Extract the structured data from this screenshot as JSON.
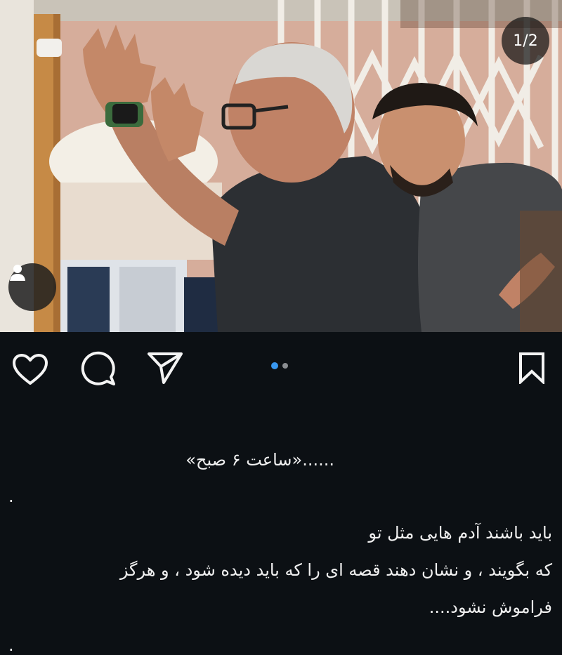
{
  "post": {
    "counter": "1/2",
    "photo_alt": "Photo of two men on a film set",
    "carousel": {
      "count": 2,
      "active": 1
    }
  },
  "actions": {
    "like_icon": "heart-icon",
    "comment_icon": "comment-icon",
    "share_icon": "send-icon",
    "save_icon": "bookmark-icon"
  },
  "caption": {
    "heading": "......«ساعت ۶ صبح»",
    "dot_line": ".",
    "line1": "باید باشند آدم هایی مثل تو",
    "line2": "که بگویند ، و نشان دهند قصه ای را که باید دیده شود ، و هرگز",
    "line3": "فراموش نشود....",
    "edge_mark": "."
  },
  "colors": {
    "background": "#0c1014",
    "accent": "#3897f0",
    "text": "#f0f0f0"
  }
}
